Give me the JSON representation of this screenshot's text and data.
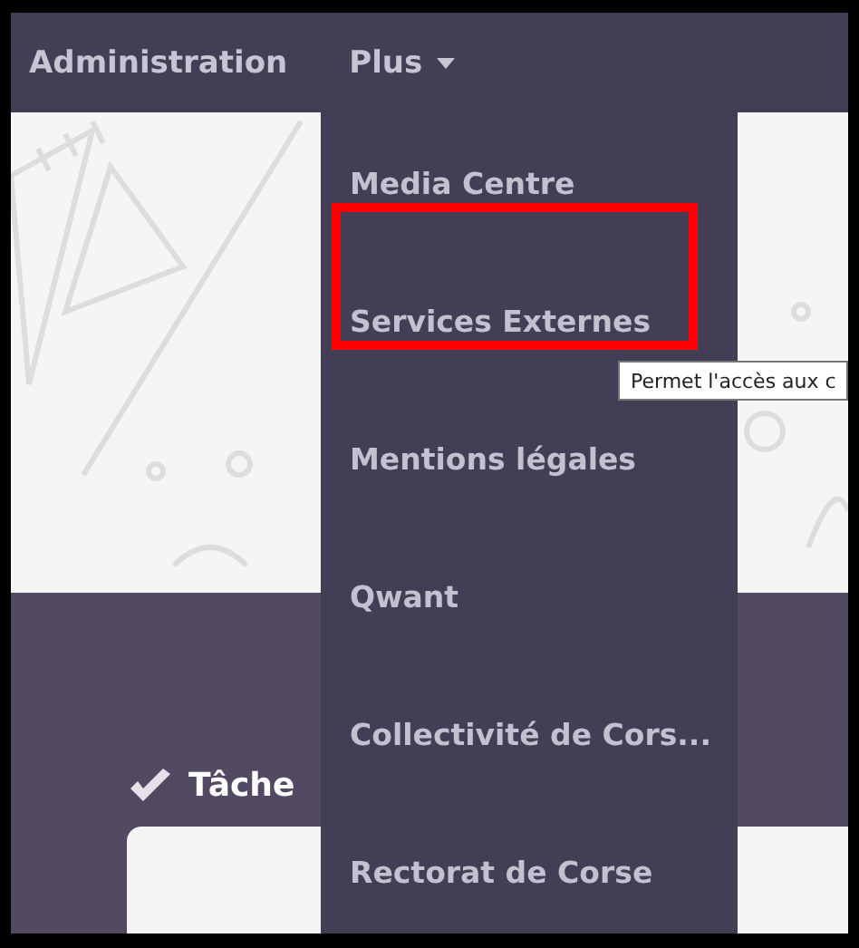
{
  "nav": [
    {
      "label": "Administration",
      "kind": "link"
    },
    {
      "label": "Plus",
      "kind": "dropdown",
      "expanded": true
    }
  ],
  "menu": {
    "items": [
      {
        "label": "Media Centre",
        "highlighted": false
      },
      {
        "label": "Services Externes",
        "highlighted": true
      },
      {
        "label": "Mentions légales",
        "highlighted": false
      },
      {
        "label": "Qwant",
        "highlighted": false
      },
      {
        "label": "Collectivité de Cors...",
        "highlighted": false
      },
      {
        "label": "Rectorat de Corse",
        "highlighted": false
      }
    ]
  },
  "tooltip": "Permet l'accès aux c",
  "section": {
    "title": "Tâche"
  }
}
